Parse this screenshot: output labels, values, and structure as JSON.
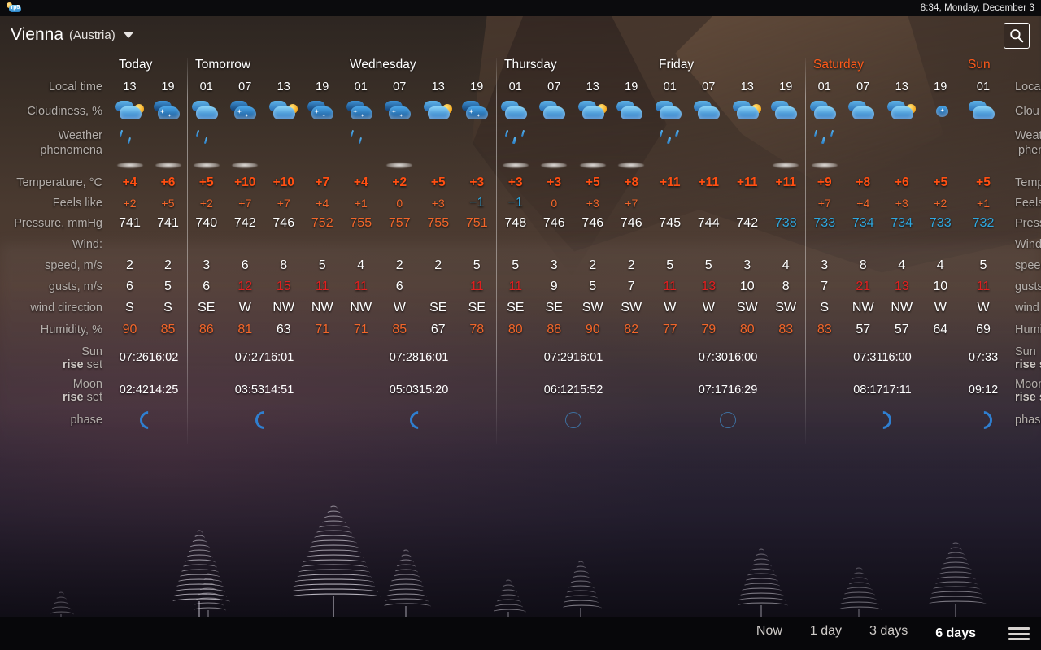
{
  "statusbar": {
    "clock": "8:34, Monday, December 3",
    "logo_text": "rp5"
  },
  "header": {
    "city": "Vienna",
    "country": "(Austria)",
    "caret_icon": "chevron-down-icon",
    "search_icon": "search-icon"
  },
  "row_labels": {
    "local_time": "Local time",
    "cloudiness": "Cloudiness, %",
    "weather_phenomena_1": "Weather",
    "weather_phenomena_2": "phenomena",
    "temperature": "Temperature, °C",
    "feels_like": "Feels like",
    "pressure": "Pressure, mmHg",
    "wind": "Wind:",
    "speed": "speed, m/s",
    "gusts": "gusts, m/s",
    "wind_direction": "wind direction",
    "humidity": "Humidity, %",
    "sun": "Sun",
    "sun_rise": "rise",
    "sun_set": "set",
    "moon": "Moon",
    "moon_rise": "rise",
    "moon_set": "set",
    "phase": "phase"
  },
  "row_labels_right": {
    "local_time": "Local",
    "cloudiness": "Clou",
    "weather_phenomena_1": "Weat",
    "weather_phenomena_2": "phen",
    "temperature": "Temp",
    "feels_like": "Feels",
    "pressure": "Press",
    "wind": "Wind",
    "speed": "speed",
    "gusts": "gusts",
    "wind_direction": "wind",
    "humidity": "Humi",
    "sun": "Sun",
    "sun_rs": "rise s",
    "moon": "Moon",
    "moon_rs": "rise s",
    "phase": "phase"
  },
  "days": [
    {
      "name": "Today",
      "weekend": false,
      "slots": 2,
      "times": [
        "13",
        "19"
      ],
      "icons": [
        {
          "type": "cloud-sun-icon",
          "sun": true,
          "night": false
        },
        {
          "type": "cloud-night-icon",
          "sun": false,
          "night": true
        }
      ],
      "phenomena": [
        {
          "drops": 2
        },
        {
          "drops": 1
        }
      ],
      "fog": [
        true,
        true
      ],
      "temperature": [
        "+4",
        "+6"
      ],
      "feels_like": [
        "+2",
        "+5"
      ],
      "pressure": [
        "741",
        "741"
      ],
      "pressure_color": [
        "white",
        "white"
      ],
      "speed": [
        "2",
        "2"
      ],
      "gusts": [
        "6",
        "5"
      ],
      "gusts_color": [
        "white",
        "white"
      ],
      "wind_direction": [
        "S",
        "S"
      ],
      "humidity": [
        "90",
        "85"
      ],
      "humidity_color": [
        "orange",
        "orange"
      ],
      "sun_rise": "07:26",
      "sun_set": "16:02",
      "moon_rise": "02:42",
      "moon_set": "14:25",
      "moon_phase": "waning"
    },
    {
      "name": "Tomorrow",
      "weekend": false,
      "slots": 4,
      "times": [
        "01",
        "07",
        "13",
        "19"
      ],
      "icons": [
        {
          "type": "cloud-rain-icon",
          "sun": false,
          "night": false
        },
        {
          "type": "cloud-night-icon",
          "sun": false,
          "night": true
        },
        {
          "type": "cloud-sun-icon",
          "sun": true,
          "night": false
        },
        {
          "type": "cloud-night-icon",
          "sun": false,
          "night": true
        }
      ],
      "phenomena": [
        {
          "drops": 2
        },
        {
          "drops": 2
        },
        {
          "drops": 0
        },
        {
          "drops": 0
        }
      ],
      "fog": [
        true,
        true,
        false,
        false
      ],
      "temperature": [
        "+5",
        "+10",
        "+10",
        "+7"
      ],
      "feels_like": [
        "+2",
        "+7",
        "+7",
        "+4"
      ],
      "pressure": [
        "740",
        "742",
        "746",
        "752"
      ],
      "pressure_color": [
        "white",
        "white",
        "white",
        "orange"
      ],
      "speed": [
        "3",
        "6",
        "8",
        "5"
      ],
      "gusts": [
        "6",
        "12",
        "15",
        "11"
      ],
      "gusts_color": [
        "white",
        "red",
        "red",
        "red"
      ],
      "wind_direction": [
        "SE",
        "W",
        "NW",
        "NW"
      ],
      "humidity": [
        "86",
        "81",
        "63",
        "71"
      ],
      "humidity_color": [
        "orange",
        "orange",
        "white",
        "orange"
      ],
      "sun_rise": "07:27",
      "sun_set": "16:01",
      "moon_rise": "03:53",
      "moon_set": "14:51",
      "moon_phase": "waning"
    },
    {
      "name": "Wednesday",
      "weekend": false,
      "slots": 4,
      "times": [
        "01",
        "07",
        "13",
        "19"
      ],
      "icons": [
        {
          "type": "cloud-night-icon",
          "sun": false,
          "night": true
        },
        {
          "type": "cloud-night-icon",
          "sun": false,
          "night": true
        },
        {
          "type": "cloud-sun-icon",
          "sun": true,
          "night": false
        },
        {
          "type": "cloud-night-icon",
          "sun": false,
          "night": true
        }
      ],
      "phenomena": [
        {
          "drops": 0
        },
        {
          "drops": 0
        },
        {
          "drops": 0
        },
        {
          "drops": 2
        }
      ],
      "fog": [
        false,
        true,
        false,
        false
      ],
      "temperature": [
        "+4",
        "+2",
        "+5",
        "+3"
      ],
      "feels_like": [
        "+1",
        "0",
        "+3",
        "−1"
      ],
      "feels_color": [
        "orange",
        "orange",
        "orange",
        "cyan"
      ],
      "pressure": [
        "755",
        "757",
        "755",
        "751"
      ],
      "pressure_color": [
        "orange",
        "orange",
        "orange",
        "orange"
      ],
      "speed": [
        "4",
        "2",
        "2",
        "5"
      ],
      "gusts": [
        "11",
        "6",
        "",
        "11"
      ],
      "gusts_color": [
        "red",
        "white",
        "white",
        "red"
      ],
      "wind_direction": [
        "NW",
        "W",
        "SE",
        "SE"
      ],
      "humidity": [
        "71",
        "85",
        "67",
        "78"
      ],
      "humidity_color": [
        "orange",
        "orange",
        "white",
        "orange"
      ],
      "sun_rise": "07:28",
      "sun_set": "16:01",
      "moon_rise": "05:03",
      "moon_set": "15:20",
      "moon_phase": "waning"
    },
    {
      "name": "Thursday",
      "weekend": false,
      "slots": 4,
      "times": [
        "01",
        "07",
        "13",
        "19"
      ],
      "icons": [
        {
          "type": "cloud-rain-icon",
          "sun": false,
          "night": false
        },
        {
          "type": "cloud-rain-icon",
          "sun": false,
          "night": false
        },
        {
          "type": "cloud-sun-icon",
          "sun": true,
          "night": false
        },
        {
          "type": "cloud-rain-icon",
          "sun": false,
          "night": false
        }
      ],
      "phenomena": [
        {
          "drops": 2
        },
        {
          "drops": 4
        },
        {
          "drops": 4
        },
        {
          "drops": 2
        }
      ],
      "fog": [
        true,
        true,
        true,
        true
      ],
      "temperature": [
        "+3",
        "+3",
        "+5",
        "+8"
      ],
      "feels_like": [
        "−1",
        "0",
        "+3",
        "+7"
      ],
      "feels_color": [
        "cyan",
        "orange",
        "orange",
        "orange"
      ],
      "pressure": [
        "748",
        "746",
        "746",
        "746"
      ],
      "pressure_color": [
        "white",
        "white",
        "white",
        "white"
      ],
      "speed": [
        "5",
        "3",
        "2",
        "2"
      ],
      "gusts": [
        "11",
        "9",
        "5",
        "7"
      ],
      "gusts_color": [
        "red",
        "white",
        "white",
        "white"
      ],
      "wind_direction": [
        "SE",
        "SE",
        "SW",
        "SW"
      ],
      "humidity": [
        "80",
        "88",
        "90",
        "82"
      ],
      "humidity_color": [
        "orange",
        "orange",
        "orange",
        "orange"
      ],
      "sun_rise": "07:29",
      "sun_set": "16:01",
      "moon_rise": "06:12",
      "moon_set": "15:52",
      "moon_phase": "new"
    },
    {
      "name": "Friday",
      "weekend": false,
      "slots": 4,
      "times": [
        "01",
        "07",
        "13",
        "19"
      ],
      "icons": [
        {
          "type": "cloud-rain-icon",
          "sun": false,
          "night": false
        },
        {
          "type": "cloud-rain-icon",
          "sun": false,
          "night": false
        },
        {
          "type": "cloud-sun-icon",
          "sun": true,
          "night": false
        },
        {
          "type": "cloud-rain-icon",
          "sun": false,
          "night": false
        }
      ],
      "phenomena": [
        {
          "drops": 2
        },
        {
          "drops": 2
        },
        {
          "drops": 2
        },
        {
          "drops": 5
        }
      ],
      "fog": [
        false,
        false,
        false,
        true
      ],
      "temperature": [
        "+11",
        "+11",
        "+11",
        "+11"
      ],
      "feels_like": [
        "",
        "",
        "",
        ""
      ],
      "pressure": [
        "745",
        "744",
        "742",
        "738"
      ],
      "pressure_color": [
        "white",
        "white",
        "white",
        "cyan"
      ],
      "speed": [
        "5",
        "5",
        "3",
        "4"
      ],
      "gusts": [
        "11",
        "13",
        "10",
        "8"
      ],
      "gusts_color": [
        "red",
        "red",
        "white",
        "white"
      ],
      "wind_direction": [
        "W",
        "W",
        "SW",
        "SW"
      ],
      "humidity": [
        "77",
        "79",
        "80",
        "83"
      ],
      "humidity_color": [
        "orange",
        "orange",
        "orange",
        "orange"
      ],
      "sun_rise": "07:30",
      "sun_set": "16:00",
      "moon_rise": "07:17",
      "moon_set": "16:29",
      "moon_phase": "new"
    },
    {
      "name": "Saturday",
      "weekend": true,
      "slots": 4,
      "times": [
        "01",
        "07",
        "13",
        "19"
      ],
      "icons": [
        {
          "type": "cloud-rain-icon",
          "sun": false,
          "night": false
        },
        {
          "type": "cloud-rain-icon",
          "sun": false,
          "night": false
        },
        {
          "type": "cloud-sun-icon",
          "sun": true,
          "night": false
        },
        {
          "type": "clear-night-icon",
          "sun": false,
          "night": true
        }
      ],
      "phenomena": [
        {
          "drops": 4
        },
        {
          "drops": 4
        },
        {
          "drops": 0
        },
        {
          "drops": 0
        }
      ],
      "fog": [
        true,
        false,
        false,
        false
      ],
      "temperature": [
        "+9",
        "+8",
        "+6",
        "+5"
      ],
      "feels_like": [
        "+7",
        "+4",
        "+3",
        "+2"
      ],
      "pressure": [
        "733",
        "734",
        "734",
        "733"
      ],
      "pressure_color": [
        "cyan",
        "cyan",
        "cyan",
        "cyan"
      ],
      "speed": [
        "3",
        "8",
        "4",
        "4"
      ],
      "gusts": [
        "7",
        "21",
        "13",
        "10"
      ],
      "gusts_color": [
        "white",
        "red",
        "red",
        "white"
      ],
      "wind_direction": [
        "S",
        "NW",
        "NW",
        "W"
      ],
      "humidity": [
        "83",
        "57",
        "57",
        "64"
      ],
      "humidity_color": [
        "orange",
        "white",
        "white",
        "white"
      ],
      "sun_rise": "07:31",
      "sun_set": "16:00",
      "moon_rise": "08:17",
      "moon_set": "17:11",
      "moon_phase": "waxing"
    },
    {
      "name": "Sun",
      "weekend": true,
      "slots": 1,
      "times": [
        "01"
      ],
      "icons": [
        {
          "type": "cloud-rain-icon",
          "sun": false,
          "night": false
        }
      ],
      "phenomena": [
        {
          "drops": 0
        }
      ],
      "fog": [
        false
      ],
      "temperature": [
        "+5"
      ],
      "feels_like": [
        "+1"
      ],
      "pressure": [
        "732"
      ],
      "pressure_color": [
        "cyan"
      ],
      "speed": [
        "5"
      ],
      "gusts": [
        "11"
      ],
      "gusts_color": [
        "red"
      ],
      "wind_direction": [
        "W"
      ],
      "humidity": [
        "69"
      ],
      "humidity_color": [
        "white"
      ],
      "sun_rise": "07:33",
      "sun_set": "",
      "moon_rise": "09:12",
      "moon_set": "",
      "moon_phase": "waxing"
    }
  ],
  "bottombar": {
    "links": [
      {
        "label": "Now",
        "active": false
      },
      {
        "label": "1 day",
        "active": false
      },
      {
        "label": "3 days",
        "active": false
      },
      {
        "label": "6 days",
        "active": true
      }
    ],
    "menu_icon": "hamburger-menu-icon"
  },
  "colors": {
    "accent_orange": "#ff5a1a",
    "hot_red": "#e02020",
    "cold_cyan": "#2ea8e0",
    "label_grey": "#b4aeaa"
  }
}
